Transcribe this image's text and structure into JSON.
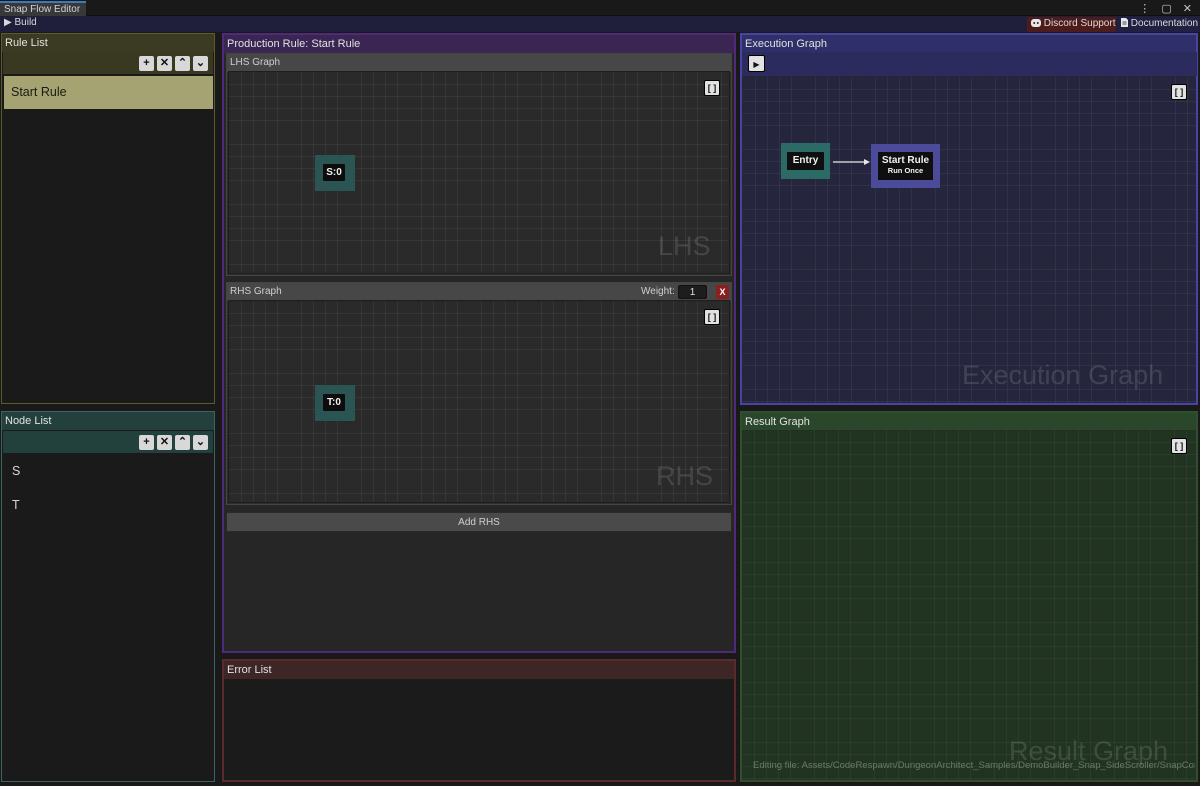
{
  "window": {
    "tab_title": "Snap Flow Editor",
    "controls": "⋮ ▢ ✕"
  },
  "toolbar": {
    "build_label": "Build",
    "discord_label": "Discord Support",
    "docs_label": "Documentation"
  },
  "rule_list": {
    "title": "Rule List",
    "items": [
      "Start Rule"
    ],
    "selected_item": "Start Rule",
    "buttons": {
      "add": "+",
      "remove": "✕",
      "up": "⌃",
      "down": "⌄"
    }
  },
  "node_list": {
    "title": "Node List",
    "items": [
      "S",
      "T"
    ],
    "buttons": {
      "add": "+",
      "remove": "✕",
      "up": "⌃",
      "down": "⌄"
    }
  },
  "production_rule": {
    "title": "Production Rule: Start Rule",
    "lhs": {
      "title": "LHS Graph",
      "watermark": "LHS",
      "nodes": [
        "S:0"
      ],
      "frame_button": "[ ]"
    },
    "rhs": {
      "title": "RHS Graph",
      "weight_label": "Weight:",
      "weight_value": "1",
      "delete_label": "X",
      "watermark": "RHS",
      "nodes": [
        "T:0"
      ],
      "frame_button": "[ ]"
    },
    "add_rhs_label": "Add RHS"
  },
  "error_list": {
    "title": "Error List"
  },
  "execution_graph": {
    "title": "Execution Graph",
    "watermark": "Execution Graph",
    "play_icon": "▶",
    "frame_button": "[ ]",
    "entry_node": "Entry",
    "rule_node": {
      "title": "Start Rule",
      "subtitle": "Run Once"
    }
  },
  "result_graph": {
    "title": "Result Graph",
    "watermark": "Result Graph",
    "frame_button": "[ ]",
    "status_text": "Editing file: Assets/CodeRespawn/DungeonArchitect_Samples/DemoBuilder_Snap_SideScroller/SnapCont"
  },
  "colors": {
    "rule_panel": "#5e5a2e",
    "node_panel": "#3e6461",
    "production_panel": "#4f2a7c",
    "error_panel": "#5a2b2b",
    "execution_panel": "#4744a6",
    "result_panel": "#2f4f2f",
    "selected_rule": "#a5a372",
    "discord_button": "#4a1c1c"
  }
}
